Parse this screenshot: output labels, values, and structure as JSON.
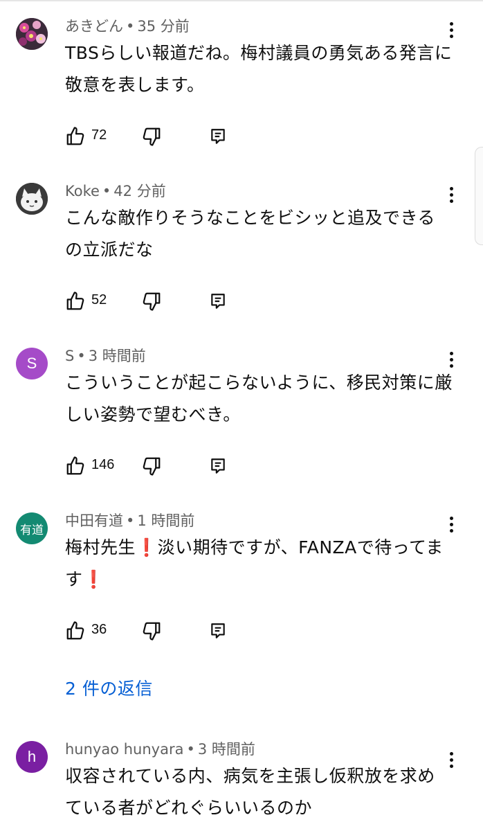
{
  "comments": [
    {
      "author": "あきどん",
      "time": "35 分前",
      "text": "TBSらしい報道だね。梅村議員の勇気ある発言に敬意を表します。",
      "likes": "72",
      "avatar_type": "photo-flowers"
    },
    {
      "author": "Koke",
      "time": "42 分前",
      "text": "こんな敵作りそうなことをビシッと追及できるの立派だな",
      "likes": "52",
      "avatar_type": "photo-cat"
    },
    {
      "author": "S",
      "time": "3 時間前",
      "text": "こういうことが起こらないように、移民対策に厳しい姿勢で望むべき。",
      "likes": "146",
      "avatar_letter": "S",
      "avatar_color": "#a54bc8"
    },
    {
      "author": "中田有道",
      "time": "1 時間前",
      "text_part1": "梅村先生",
      "text_part2": "淡い期待ですが、FANZAで待ってます",
      "emoji": "❗",
      "likes": "36",
      "avatar_letter": "有道",
      "avatar_color": "#138a72"
    },
    {
      "author": "hunyao hunyara",
      "time": "3 時間前",
      "text": "収容されている内、病気を主張し仮釈放を求めている者がどれぐらいいるのか",
      "avatar_letter": "h",
      "avatar_color": "#7a1fa2"
    }
  ],
  "replies_link": "2 件の返信",
  "separator": "•",
  "colors": {
    "link": "#065fd4",
    "meta": "#606060",
    "text": "#0f0f0f",
    "emoji": "#e0242b"
  },
  "icons": [
    "like-icon",
    "dislike-icon",
    "reply-icon",
    "more-vert-icon"
  ]
}
